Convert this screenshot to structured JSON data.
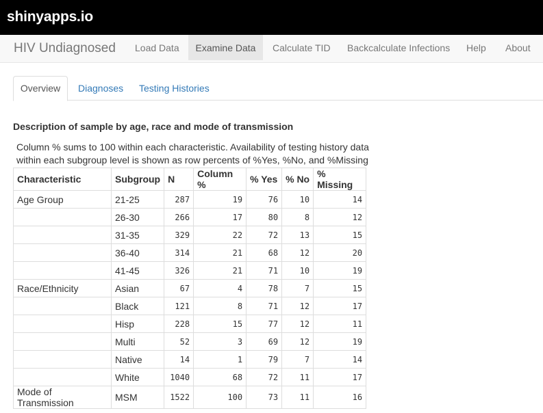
{
  "site": {
    "brand": "shinyapps.io"
  },
  "navbar": {
    "title": "HIV Undiagnosed",
    "items": [
      "Load Data",
      "Examine Data",
      "Calculate TID",
      "Backcalculate Infections",
      "Help",
      "About"
    ],
    "active": "Examine Data"
  },
  "tabs": {
    "items": [
      "Overview",
      "Diagnoses",
      "Testing Histories"
    ],
    "active": "Overview"
  },
  "content": {
    "title": "Description of sample by age, race and mode of transmission",
    "caption_line1": "Column % sums to 100 within each characteristic. Availability of testing history data",
    "caption_line2": "within each subgroup level is shown as row percents of %Yes, %No, and %Missing"
  },
  "table": {
    "headers": [
      "Characteristic",
      "Subgroup",
      "N",
      "Column %",
      "% Yes",
      "% No",
      "% Missing"
    ],
    "rows": [
      [
        "Age Group",
        "21-25",
        "287",
        "19",
        "76",
        "10",
        "14"
      ],
      [
        "",
        "26-30",
        "266",
        "17",
        "80",
        "8",
        "12"
      ],
      [
        "",
        "31-35",
        "329",
        "22",
        "72",
        "13",
        "15"
      ],
      [
        "",
        "36-40",
        "314",
        "21",
        "68",
        "12",
        "20"
      ],
      [
        "",
        "41-45",
        "326",
        "21",
        "71",
        "10",
        "19"
      ],
      [
        "Race/Ethnicity",
        "Asian",
        "67",
        "4",
        "78",
        "7",
        "15"
      ],
      [
        "",
        "Black",
        "121",
        "8",
        "71",
        "12",
        "17"
      ],
      [
        "",
        "Hisp",
        "228",
        "15",
        "77",
        "12",
        "11"
      ],
      [
        "",
        "Multi",
        "52",
        "3",
        "69",
        "12",
        "19"
      ],
      [
        "",
        "Native",
        "14",
        "1",
        "79",
        "7",
        "14"
      ],
      [
        "",
        "White",
        "1040",
        "68",
        "72",
        "11",
        "17"
      ],
      [
        "Mode of Transmission",
        "MSM",
        "1522",
        "100",
        "73",
        "11",
        "16"
      ]
    ]
  }
}
